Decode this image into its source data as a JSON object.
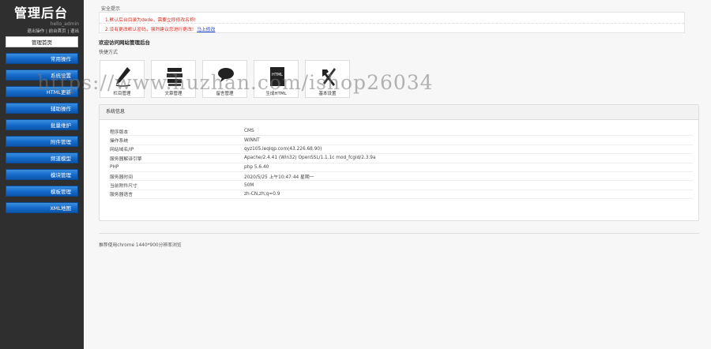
{
  "sidebar": {
    "brand": "管理后台",
    "user": "hello_admin",
    "links": [
      "退出操作",
      "前台首页",
      "退出"
    ],
    "items": [
      {
        "label": "管理首页",
        "active": true
      },
      {
        "label": "常用操作"
      },
      {
        "label": "系统设置"
      },
      {
        "label": "HTML更新"
      },
      {
        "label": "辅助操作"
      },
      {
        "label": "批量维护"
      },
      {
        "label": "附件管理"
      },
      {
        "label": "频道模型"
      },
      {
        "label": "模块管理"
      },
      {
        "label": "模板管理"
      },
      {
        "label": "XML地图"
      }
    ]
  },
  "main": {
    "security_title": "安全提示",
    "notices": [
      {
        "text": "1.默认后台目录为dede，需要立即修改名称!"
      },
      {
        "text": "2.没有更改默认密码，强烈建议您进行更改!",
        "link": "马上修改"
      }
    ],
    "welcome": "欢迎访问网站管理后台",
    "shortcut_title": "快捷方式",
    "shortcuts": [
      {
        "label": "栏目管理",
        "icon": "pencil-icon"
      },
      {
        "label": "文章管理",
        "icon": "stack-icon"
      },
      {
        "label": "留言管理",
        "icon": "speech-bubble-icon"
      },
      {
        "label": "生成HTML",
        "icon": "html-file-icon"
      },
      {
        "label": "基本设置",
        "icon": "tools-icon"
      }
    ],
    "system_title": "系统信息",
    "system_info": [
      {
        "key": "程序版本",
        "value": "CMS"
      },
      {
        "key": "操作系统",
        "value": "WINNT"
      },
      {
        "key": "网站域名/IP",
        "value": "qyz105.leqiqp.com(43.226.68.90)"
      },
      {
        "key": "服务器解译引擎",
        "value": "Apache/2.4.41 (Win32) OpenSSL/1.1.1c mod_fcgid/2.3.9a"
      },
      {
        "key": "PHP",
        "value": "php 5.6.40"
      },
      {
        "key": "服务器时间",
        "value": "2020/5/25 上午10:47:44 星期一"
      },
      {
        "key": "当前附件尺寸",
        "value": "50M"
      },
      {
        "key": "服务器语言",
        "value": "zh-CN,zh;q=0.9"
      }
    ],
    "footer_tip": "推荐使用chrome 1440*900分辨率浏览"
  },
  "watermark": "https://www.huzhan.com/ishop26034",
  "colors": {
    "sidebar_bg": "#2f2f2f",
    "nav_blue": "#1469c8",
    "notice_red": "#d62a1f",
    "link_blue": "#1a3ec8"
  }
}
